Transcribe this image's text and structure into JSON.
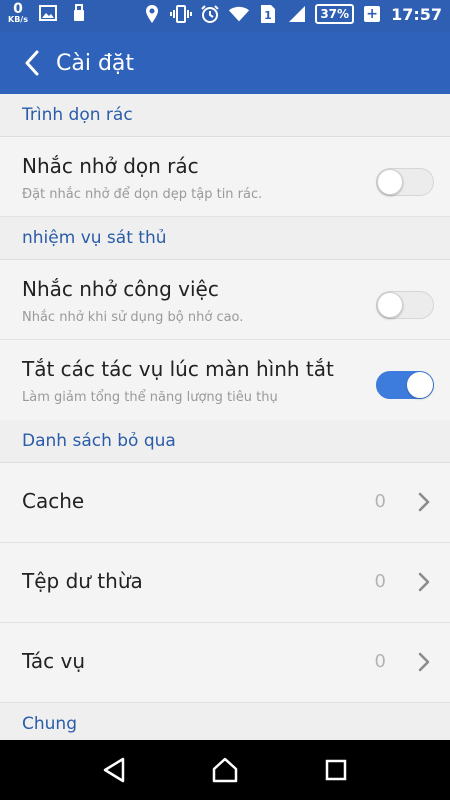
{
  "statusbar": {
    "net_speed": "0",
    "net_unit": "KB/s",
    "sim_slot": "1",
    "battery": "37%",
    "battery_plus": "+",
    "time": "17:57"
  },
  "appbar": {
    "title": "Cài đặt"
  },
  "sections": {
    "junk": {
      "header": "Trình dọn rác",
      "reminder_title": "Nhắc nhở dọn rác",
      "reminder_sub": "Đặt nhắc nhở để dọn dẹp tập tin rác.",
      "reminder_on": false
    },
    "killer": {
      "header": "nhiệm vụ sát thủ",
      "task_title": "Nhắc nhở công việc",
      "task_sub": "Nhắc nhở khi sử dụng bộ nhớ cao.",
      "task_on": false,
      "screenoff_title": "Tắt các tác vụ lúc màn hình tắt",
      "screenoff_sub": "Làm giảm tổng thể năng lượng tiêu thụ",
      "screenoff_on": true
    },
    "ignore": {
      "header": "Danh sách bỏ qua",
      "items": [
        {
          "label": "Cache",
          "count": "0"
        },
        {
          "label": "Tệp dư thừa",
          "count": "0"
        },
        {
          "label": "Tác vụ",
          "count": "0"
        }
      ]
    },
    "general": {
      "header": "Chung"
    }
  },
  "colors": {
    "statusbar": "#2f5fb3",
    "appbar": "#2f62ba",
    "accent": "#3d7bdc",
    "section_text": "#2a5caa"
  }
}
